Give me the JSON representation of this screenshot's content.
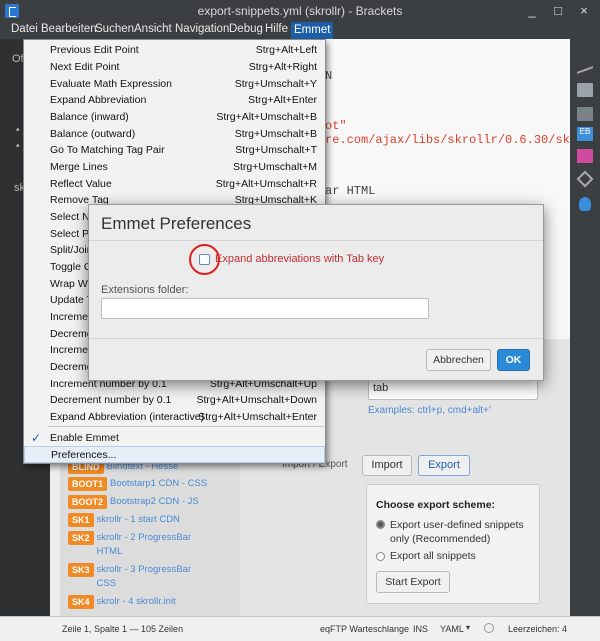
{
  "titlebar": {
    "title": "export-snippets.yml (skrollr) - Brackets",
    "minimize": "_",
    "maximize": "□",
    "close": "×"
  },
  "menubar": [
    "Datei",
    "Bearbeiten",
    "Suchen",
    "Ansicht",
    "Navigation",
    "Debug",
    "Hilfe",
    "Emmet"
  ],
  "sidebar": {
    "label_top": "Of",
    "label_mid": "sk"
  },
  "editor": {
    "lines": [
      "N",
      "ot\"",
      "re.com/ajax/libs/skrollr/0.6.30/skr",
      "ar HTML"
    ]
  },
  "emmet_menu": {
    "items": [
      {
        "label": "Previous Edit Point",
        "shortcut": "Strg+Alt+Left"
      },
      {
        "label": "Next Edit Point",
        "shortcut": "Strg+Alt+Right"
      },
      {
        "label": "Evaluate Math Expression",
        "shortcut": "Strg+Umschalt+Y"
      },
      {
        "label": "Expand Abbreviation",
        "shortcut": "Strg+Alt+Enter"
      },
      {
        "label": "Balance (inward)",
        "shortcut": "Strg+Alt+Umschalt+B"
      },
      {
        "label": "Balance (outward)",
        "shortcut": "Strg+Umschalt+B"
      },
      {
        "label": "Go To Matching Tag Pair",
        "shortcut": "Strg+Umschalt+T"
      },
      {
        "label": "Merge Lines",
        "shortcut": "Strg+Umschalt+M"
      },
      {
        "label": "Reflect Value",
        "shortcut": "Strg+Alt+Umschalt+R"
      },
      {
        "label": "Remove Tag",
        "shortcut": "Strg+Umschalt+K"
      },
      {
        "label": "Select Ne",
        "shortcut": ""
      },
      {
        "label": "Select Pre",
        "shortcut": ""
      },
      {
        "label": "Split/Join",
        "shortcut": ""
      },
      {
        "label": "Toggle Co",
        "shortcut": ""
      },
      {
        "label": "Wrap With",
        "shortcut": ""
      },
      {
        "label": "Update Ta",
        "shortcut": ""
      },
      {
        "label": "Increment",
        "shortcut": ""
      },
      {
        "label": "Decremen",
        "shortcut": ""
      },
      {
        "label": "Increment",
        "shortcut": ""
      },
      {
        "label": "Decremen",
        "shortcut": ""
      },
      {
        "label": "Increment number by 0.1",
        "shortcut": "Strg+Alt+Umschalt+Up"
      },
      {
        "label": "Decrement number by 0.1",
        "shortcut": "Strg+Alt+Umschalt+Down"
      },
      {
        "label": "Expand Abbreviation (interactive)",
        "shortcut": "Strg+Alt+Umschalt+Enter"
      }
    ],
    "enable_emmet": "Enable Emmet",
    "preferences": "Preferences..."
  },
  "dialog": {
    "title": "Emmet Preferences",
    "checkbox_label": "Expand abbreviations with Tab key",
    "extensions_label": "Extensions folder:",
    "extensions_value": "",
    "cancel": "Abbrechen",
    "ok": "OK",
    "highlight_color": "#e02020"
  },
  "snippets": {
    "items": [
      {
        "badge": "BLIND",
        "name": "Blindtext - Hesse"
      },
      {
        "badge": "BOOT1",
        "name": "Bootstarp1 CDN - CSS"
      },
      {
        "badge": "BOOT2",
        "name": "Bootstrap2 CDN - JS"
      },
      {
        "badge": "SK1",
        "name": "skrollr - 1 start CDN"
      },
      {
        "badge": "SK2",
        "name": "skrollr - 2 ProgressBar HTML"
      },
      {
        "badge": "SK3",
        "name": "skrollr - 3 ProgressBar CSS"
      },
      {
        "badge": "SK4",
        "name": "skrolr - 4 skrollr.init"
      }
    ],
    "shortcut_value": "tab",
    "examples": "Examples: ctrl+p, cmd+alt+'",
    "import_export_label": "Import / Export",
    "import": "Import",
    "export": "Export",
    "choose_scheme": "Choose export scheme:",
    "option1": "Export user-defined snippets only (Recommended)",
    "option2": "Export all snippets",
    "start_export": "Start Export"
  },
  "statusbar": {
    "position": "Zeile 1, Spalte 1 — 105 Zeilen",
    "eqftp": "eqFTP Warteschlange",
    "ins": "INS",
    "lang": "YAML",
    "spaces": "Leerzeichen: 4"
  }
}
